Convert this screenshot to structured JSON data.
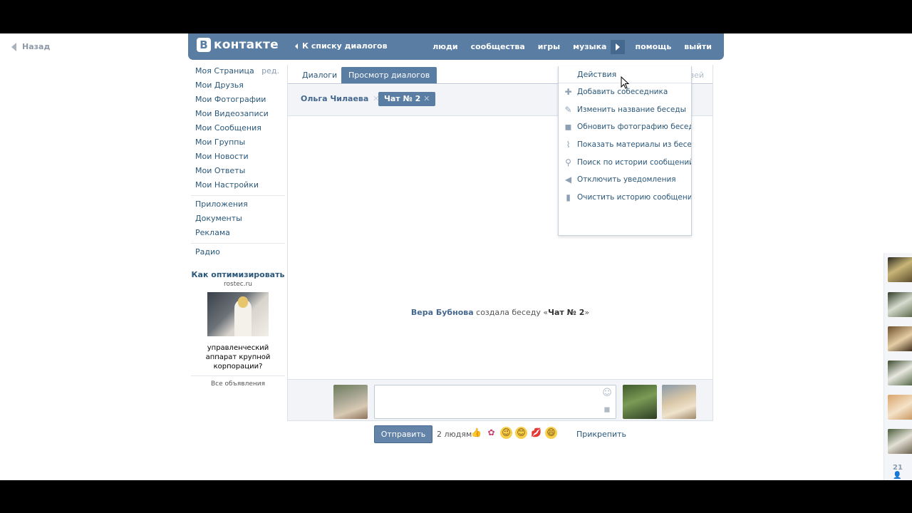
{
  "back": {
    "label": "Назад"
  },
  "header": {
    "logo_letter": "В",
    "logo_text": "контакте",
    "to_list": "К списку диалогов",
    "nav": [
      "люди",
      "сообщества",
      "игры",
      "музыка",
      "помощь",
      "выйти"
    ]
  },
  "left_menu": {
    "edit": "ред.",
    "items": [
      "Моя Страница",
      "Мои Друзья",
      "Мои Фотографии",
      "Мои Видеозаписи",
      "Мои Сообщения",
      "Мои Группы",
      "Мои Новости",
      "Мои Ответы",
      "Мои Настройки"
    ],
    "items2": [
      "Приложения",
      "Документы",
      "Реклама"
    ],
    "items3": [
      "Радио"
    ]
  },
  "ad": {
    "title": "Как оптимизировать",
    "domain": "rostec.ru",
    "text": "управленческий аппарат крупной корпорации?",
    "all": "Все объявления"
  },
  "tabs": {
    "dialogs": "Диалоги",
    "view": "Просмотр диалогов",
    "actions_hidden": "Действия",
    "to_friends": "К списку друзей"
  },
  "chats": [
    {
      "label": "Ольга Чилаева",
      "close": "✕"
    },
    {
      "label": "Чат № 2",
      "close": "✕"
    }
  ],
  "system_message": {
    "author": "Вера Бубнова",
    "action": " создала беседу «",
    "chat": "Чат № 2",
    "end": "»"
  },
  "composer": {
    "value": "",
    "send": "Отправить",
    "people": "2 людям",
    "attach": "Прикрепить"
  },
  "dropdown": {
    "head": "Действия",
    "items": [
      {
        "label": "Добавить собеседника",
        "icon": "plus-icon"
      },
      {
        "label": "Изменить название беседы",
        "icon": "pencil-icon"
      },
      {
        "label": "Обновить фотографию беседы",
        "icon": "camera-icon"
      },
      {
        "label": "Показать материалы из беседы",
        "icon": "paperclip-icon"
      },
      {
        "label": "Поиск по истории сообщений",
        "icon": "search-icon"
      },
      {
        "label": "Отключить уведомления",
        "icon": "mute-icon"
      },
      {
        "label": "Очистить историю сообщений",
        "icon": "trash-icon"
      }
    ]
  },
  "friends": {
    "count": "21"
  },
  "colors": {
    "header": "#597da3",
    "link": "#2b587a",
    "button": "#6383a8"
  }
}
